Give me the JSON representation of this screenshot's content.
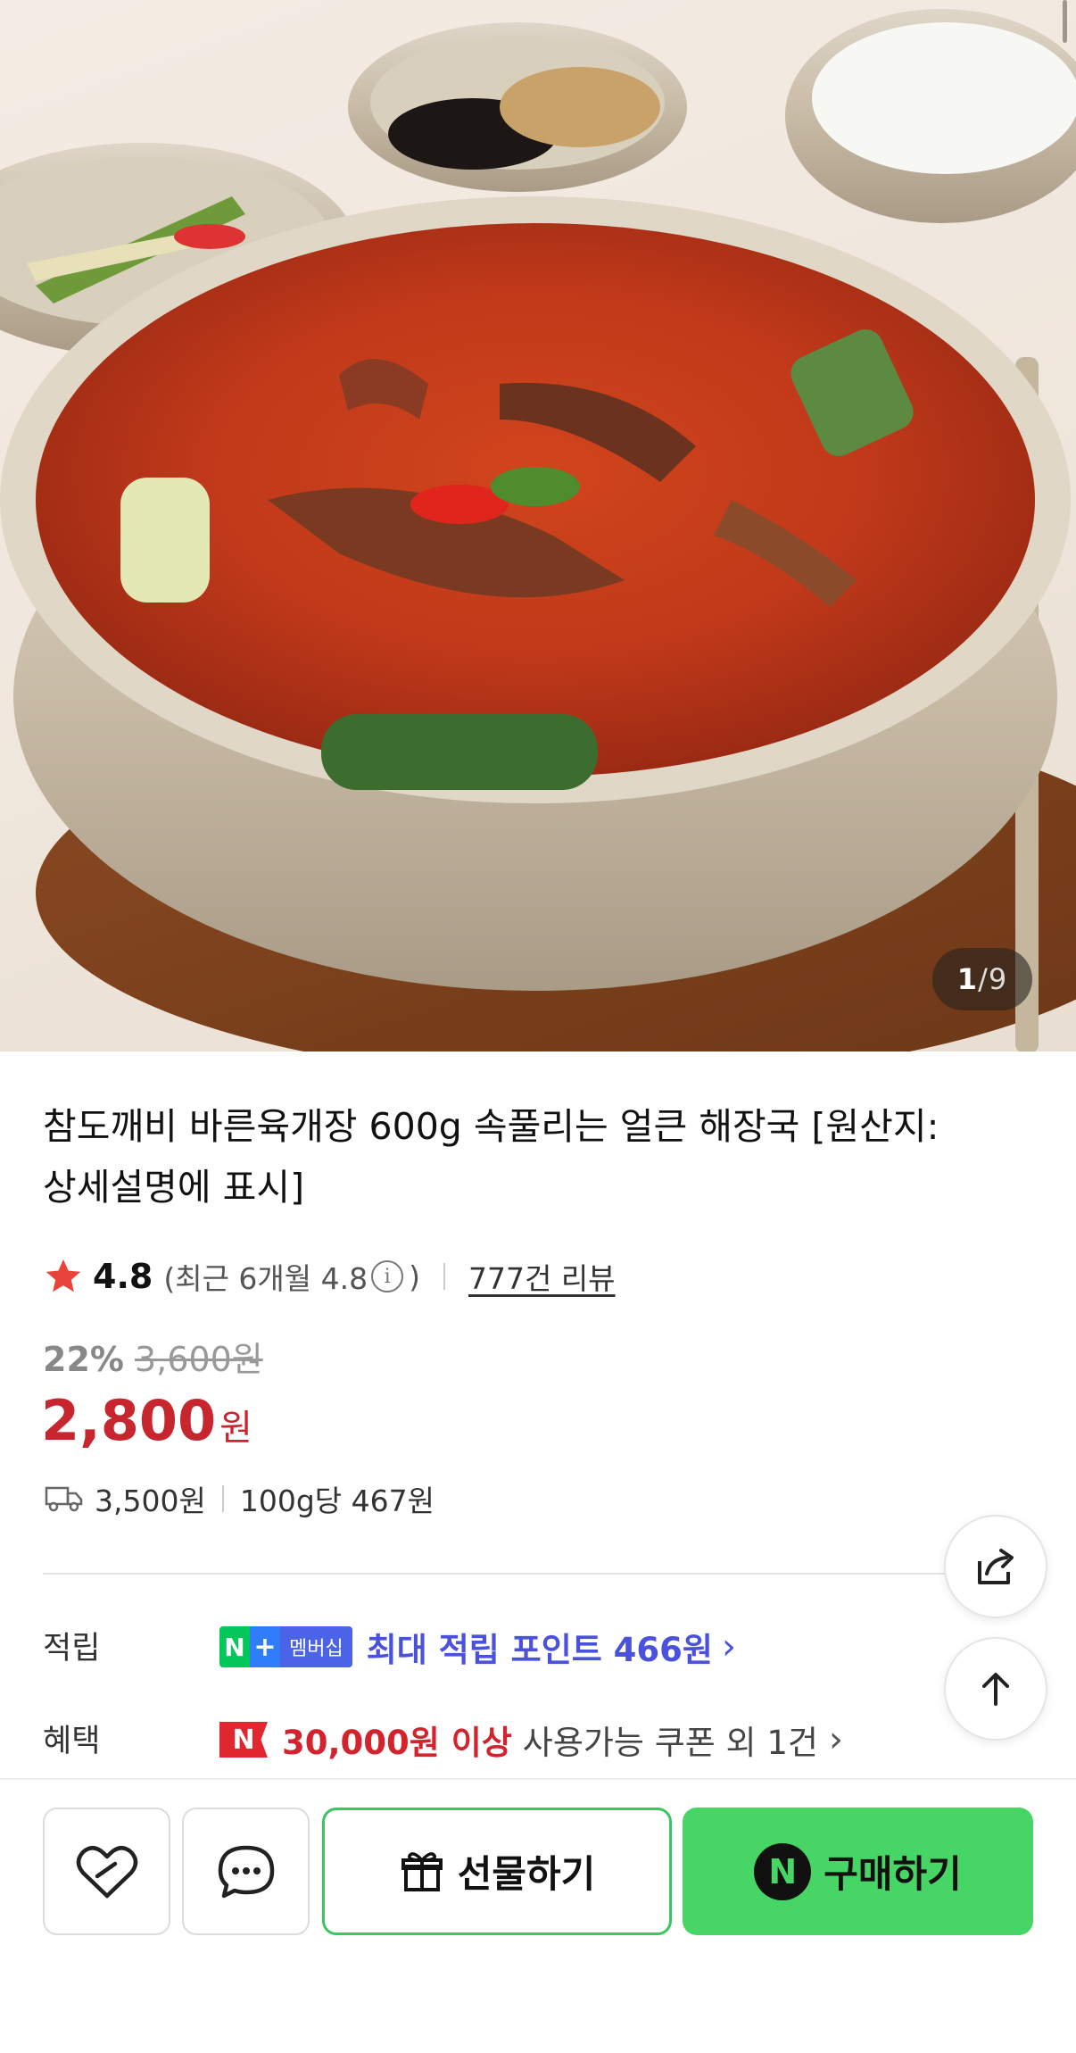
{
  "gallery": {
    "current": "1",
    "separator": "/",
    "total": "9"
  },
  "product": {
    "title": "참도깨비 바른육개장 600g 속풀리는 얼큰 해장국 [원산지:상세설명에 표시]",
    "rating": "4.8",
    "recent_rating": "(최근 6개월 4.8",
    "recent_rating_close": ")",
    "reviews_link": "777건 리뷰",
    "discount_percent": "22%",
    "original_price": "3,600원",
    "sale_price": "2,800",
    "currency": "원",
    "shipping_fee": "3,500원",
    "unit_price": "100g당 467원"
  },
  "points": {
    "label": "적립",
    "badge_n": "N",
    "badge_plus": "+",
    "badge_membership": "멤버십",
    "text": "최대 적립 포인트 466원"
  },
  "benefit": {
    "label": "혜택",
    "badge": "N",
    "strong": "30,000원 이상",
    "rest": "사용가능 쿠폰 외 1건"
  },
  "actions": {
    "gift_label": "선물하기",
    "buy_badge": "N",
    "buy_label": "구매하기"
  },
  "colors": {
    "price_red": "#c8262f",
    "points_blue": "#4a52dd",
    "buy_green": "#47d566",
    "gift_border": "#3cc65f"
  },
  "icons": [
    "star-icon",
    "info-icon",
    "truck-icon",
    "chevron-right-icon",
    "share-icon",
    "arrow-up-icon",
    "heart-link-icon",
    "chat-icon",
    "gift-icon"
  ]
}
